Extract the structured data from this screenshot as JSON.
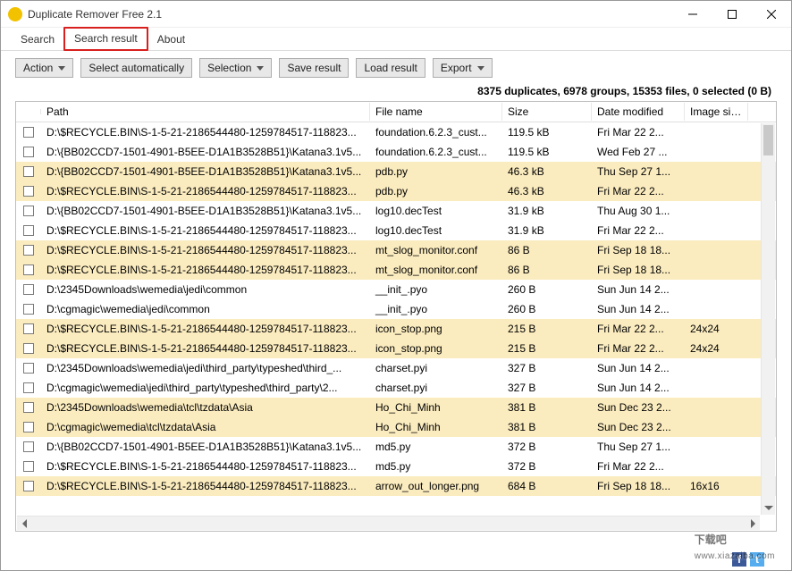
{
  "window": {
    "title": "Duplicate Remover Free 2.1"
  },
  "tabs": [
    {
      "label": "Search"
    },
    {
      "label": "Search result"
    },
    {
      "label": "About"
    }
  ],
  "toolbar": {
    "action": "Action",
    "select_auto": "Select automatically",
    "selection": "Selection",
    "save": "Save result",
    "load": "Load result",
    "export": "Export"
  },
  "status": "8375 duplicates, 6978 groups, 15353 files, 0 selected (0 B)",
  "columns": {
    "path": "Path",
    "file": "File name",
    "size": "Size",
    "date": "Date modified",
    "img": "Image size"
  },
  "rows": [
    {
      "alt": false,
      "path": "D:\\$RECYCLE.BIN\\S-1-5-21-2186544480-1259784517-118823...",
      "file": "foundation.6.2.3_cust...",
      "size": "119.5 kB",
      "date": "Fri Mar 22 2...",
      "img": ""
    },
    {
      "alt": false,
      "path": "D:\\{BB02CCD7-1501-4901-B5EE-D1A1B3528B51}\\Katana3.1v5...",
      "file": "foundation.6.2.3_cust...",
      "size": "119.5 kB",
      "date": "Wed Feb 27 ...",
      "img": ""
    },
    {
      "alt": true,
      "path": "D:\\{BB02CCD7-1501-4901-B5EE-D1A1B3528B51}\\Katana3.1v5...",
      "file": "pdb.py",
      "size": "46.3 kB",
      "date": "Thu Sep 27 1...",
      "img": ""
    },
    {
      "alt": true,
      "path": "D:\\$RECYCLE.BIN\\S-1-5-21-2186544480-1259784517-118823...",
      "file": "pdb.py",
      "size": "46.3 kB",
      "date": "Fri Mar 22 2...",
      "img": ""
    },
    {
      "alt": false,
      "path": "D:\\{BB02CCD7-1501-4901-B5EE-D1A1B3528B51}\\Katana3.1v5...",
      "file": "log10.decTest",
      "size": "31.9 kB",
      "date": "Thu Aug 30 1...",
      "img": ""
    },
    {
      "alt": false,
      "path": "D:\\$RECYCLE.BIN\\S-1-5-21-2186544480-1259784517-118823...",
      "file": "log10.decTest",
      "size": "31.9 kB",
      "date": "Fri Mar 22 2...",
      "img": ""
    },
    {
      "alt": true,
      "path": "D:\\$RECYCLE.BIN\\S-1-5-21-2186544480-1259784517-118823...",
      "file": "mt_slog_monitor.conf",
      "size": "86 B",
      "date": "Fri Sep 18 18...",
      "img": ""
    },
    {
      "alt": true,
      "path": "D:\\$RECYCLE.BIN\\S-1-5-21-2186544480-1259784517-118823...",
      "file": "mt_slog_monitor.conf",
      "size": "86 B",
      "date": "Fri Sep 18 18...",
      "img": ""
    },
    {
      "alt": false,
      "path": "D:\\2345Downloads\\wemedia\\jedi\\common",
      "file": "__init_.pyo",
      "size": "260 B",
      "date": "Sun Jun 14 2...",
      "img": ""
    },
    {
      "alt": false,
      "path": "D:\\cgmagic\\wemedia\\jedi\\common",
      "file": "__init_.pyo",
      "size": "260 B",
      "date": "Sun Jun 14 2...",
      "img": ""
    },
    {
      "alt": true,
      "path": "D:\\$RECYCLE.BIN\\S-1-5-21-2186544480-1259784517-118823...",
      "file": "icon_stop.png",
      "size": "215 B",
      "date": "Fri Mar 22 2...",
      "img": "24x24"
    },
    {
      "alt": true,
      "path": "D:\\$RECYCLE.BIN\\S-1-5-21-2186544480-1259784517-118823...",
      "file": "icon_stop.png",
      "size": "215 B",
      "date": "Fri Mar 22 2...",
      "img": "24x24"
    },
    {
      "alt": false,
      "path": "D:\\2345Downloads\\wemedia\\jedi\\third_party\\typeshed\\third_...",
      "file": "charset.pyi",
      "size": "327 B",
      "date": "Sun Jun 14 2...",
      "img": ""
    },
    {
      "alt": false,
      "path": "D:\\cgmagic\\wemedia\\jedi\\third_party\\typeshed\\third_party\\2...",
      "file": "charset.pyi",
      "size": "327 B",
      "date": "Sun Jun 14 2...",
      "img": ""
    },
    {
      "alt": true,
      "path": "D:\\2345Downloads\\wemedia\\tcl\\tzdata\\Asia",
      "file": "Ho_Chi_Minh",
      "size": "381 B",
      "date": "Sun Dec 23 2...",
      "img": ""
    },
    {
      "alt": true,
      "path": "D:\\cgmagic\\wemedia\\tcl\\tzdata\\Asia",
      "file": "Ho_Chi_Minh",
      "size": "381 B",
      "date": "Sun Dec 23 2...",
      "img": ""
    },
    {
      "alt": false,
      "path": "D:\\{BB02CCD7-1501-4901-B5EE-D1A1B3528B51}\\Katana3.1v5...",
      "file": "md5.py",
      "size": "372 B",
      "date": "Thu Sep 27 1...",
      "img": ""
    },
    {
      "alt": false,
      "path": "D:\\$RECYCLE.BIN\\S-1-5-21-2186544480-1259784517-118823...",
      "file": "md5.py",
      "size": "372 B",
      "date": "Fri Mar 22 2...",
      "img": ""
    },
    {
      "alt": true,
      "path": "D:\\$RECYCLE.BIN\\S-1-5-21-2186544480-1259784517-118823...",
      "file": "arrow_out_longer.png",
      "size": "684 B",
      "date": "Fri Sep 18 18...",
      "img": "16x16"
    }
  ],
  "watermark": {
    "main": "下载吧",
    "sub": "www.xiazaiba.com"
  }
}
